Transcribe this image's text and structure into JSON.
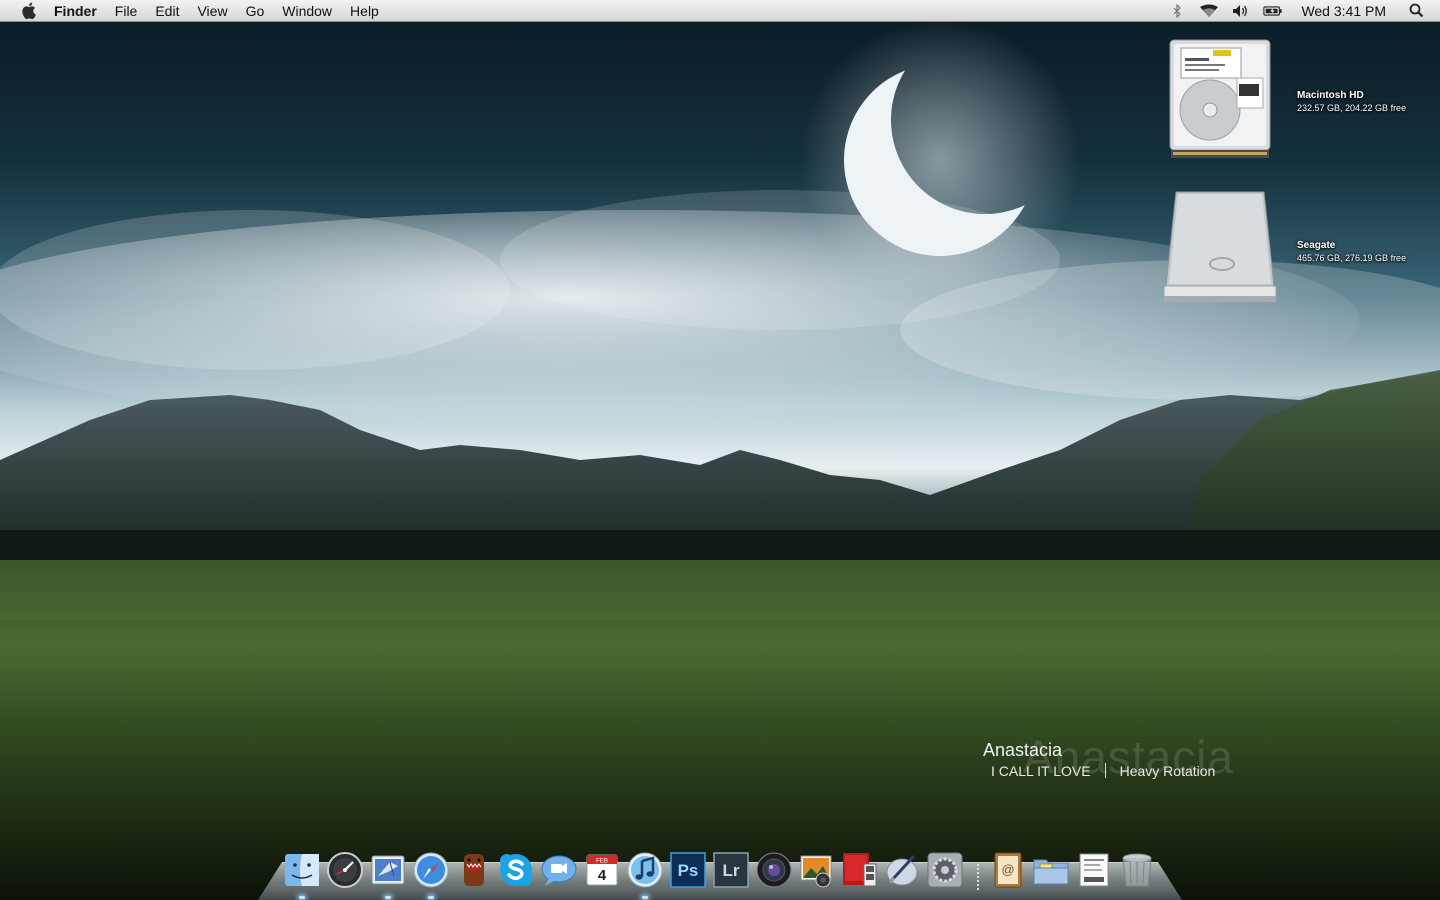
{
  "menubar": {
    "apple_icon": "apple-logo-icon",
    "app_name": "Finder",
    "menus": [
      "File",
      "Edit",
      "View",
      "Go",
      "Window",
      "Help"
    ],
    "status_icons": [
      "bluetooth-icon",
      "wifi-icon",
      "volume-icon",
      "battery-icon"
    ],
    "clock": "Wed 3:41 PM",
    "spotlight_icon": "spotlight-search-icon"
  },
  "desktop": {
    "drives": [
      {
        "name": "Macintosh HD",
        "info": "232.57 GB, 204.22 GB free",
        "icon": "internal-hard-drive-icon"
      },
      {
        "name": "Seagate",
        "info": "465.76 GB, 276.19 GB free",
        "icon": "external-drive-icon"
      }
    ]
  },
  "now_playing": {
    "artist": "Anastacia",
    "artist_ghost": "Anastacia",
    "track": "I CALL IT LOVE",
    "album": "Heavy Rotation"
  },
  "dock": {
    "apps": [
      {
        "name": "Finder",
        "icon": "finder-icon",
        "running": true
      },
      {
        "name": "Dashboard",
        "icon": "dashboard-icon",
        "running": false
      },
      {
        "name": "Mail",
        "icon": "mail-icon",
        "running": true
      },
      {
        "name": "Safari",
        "icon": "safari-icon",
        "running": true
      },
      {
        "name": "Domo",
        "icon": "domo-icon",
        "running": false
      },
      {
        "name": "Skype",
        "icon": "skype-icon",
        "running": false
      },
      {
        "name": "iChat",
        "icon": "ichat-icon",
        "running": false
      },
      {
        "name": "iCal",
        "icon": "ical-icon",
        "running": false
      },
      {
        "name": "iTunes",
        "icon": "itunes-icon",
        "running": true
      },
      {
        "name": "Photoshop",
        "icon": "photoshop-icon",
        "running": false
      },
      {
        "name": "Lightroom",
        "icon": "lightroom-icon",
        "running": false
      },
      {
        "name": "Aperture",
        "icon": "aperture-icon",
        "running": false
      },
      {
        "name": "iPhoto",
        "icon": "iphoto-icon",
        "running": false
      },
      {
        "name": "Photo Booth",
        "icon": "photo-booth-icon",
        "running": false
      },
      {
        "name": "Script Editor",
        "icon": "script-editor-icon",
        "running": false
      },
      {
        "name": "System Preferences",
        "icon": "system-preferences-icon",
        "running": false
      }
    ],
    "stacks": [
      {
        "name": "Address Book",
        "icon": "address-book-icon"
      },
      {
        "name": "Documents",
        "icon": "documents-stack-icon"
      },
      {
        "name": "Downloads",
        "icon": "downloads-stack-icon"
      },
      {
        "name": "Trash",
        "icon": "trash-icon"
      }
    ],
    "icon_labels": {
      "ical_month": "FEB",
      "ical_day": "4",
      "photoshop": "Ps",
      "lightroom": "Lr"
    }
  }
}
